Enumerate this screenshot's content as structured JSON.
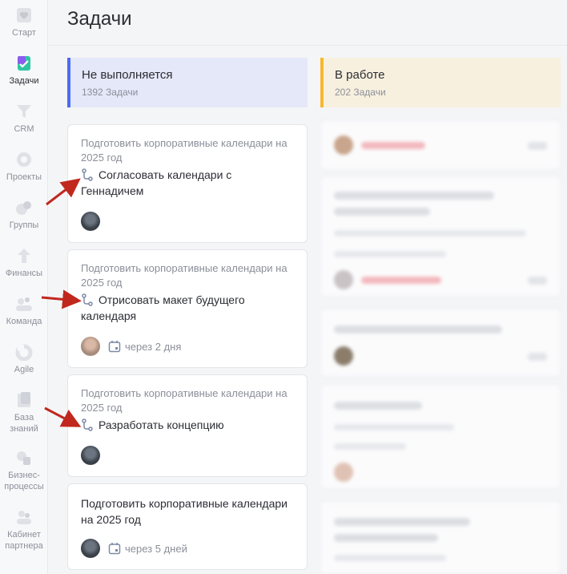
{
  "sidebar": {
    "items": [
      {
        "label": "Старт",
        "icon": "heart-icon"
      },
      {
        "label": "Задачи",
        "icon": "tasks-icon",
        "active": true
      },
      {
        "label": "CRM",
        "icon": "crm-icon"
      },
      {
        "label": "Проекты",
        "icon": "projects-icon"
      },
      {
        "label": "Группы",
        "icon": "groups-icon"
      },
      {
        "label": "Финансы",
        "icon": "finance-icon"
      },
      {
        "label": "Команда",
        "icon": "team-icon"
      },
      {
        "label": "Agile",
        "icon": "agile-icon"
      },
      {
        "label": "База знаний",
        "icon": "knowledge-base-icon"
      },
      {
        "label": "Бизнес-процессы",
        "icon": "business-process-icon"
      },
      {
        "label": "Кабинет партнера",
        "icon": "partner-cabinet-icon"
      }
    ]
  },
  "header": {
    "title": "Задачи"
  },
  "columns": [
    {
      "title": "Не выполняется",
      "count": "1392 Задачи",
      "accent": "#4a6cf7"
    },
    {
      "title": "В работе",
      "count": "202 Задачи",
      "accent": "#f5b82e"
    }
  ],
  "cards": [
    {
      "parent": "Подготовить корпоративные календари на 2025 год",
      "title": "Согласовать календари с Геннадичем",
      "subtask": true,
      "due": ""
    },
    {
      "parent": "Подготовить корпоративные календари на 2025 год",
      "title": "Отрисовать макет будущего календаря",
      "subtask": true,
      "due": "через 2 дня"
    },
    {
      "parent": "Подготовить корпоративные календари на 2025 год",
      "title": "Разработать концепцию",
      "subtask": true,
      "due": ""
    },
    {
      "parent": "",
      "title": "Подготовить корпоративные календари на 2025 год",
      "subtask": false,
      "due": "через 5 дней"
    }
  ],
  "colors": {
    "annotation_arrow": "#c0281e",
    "brand_accent": "#7b4fe0"
  }
}
